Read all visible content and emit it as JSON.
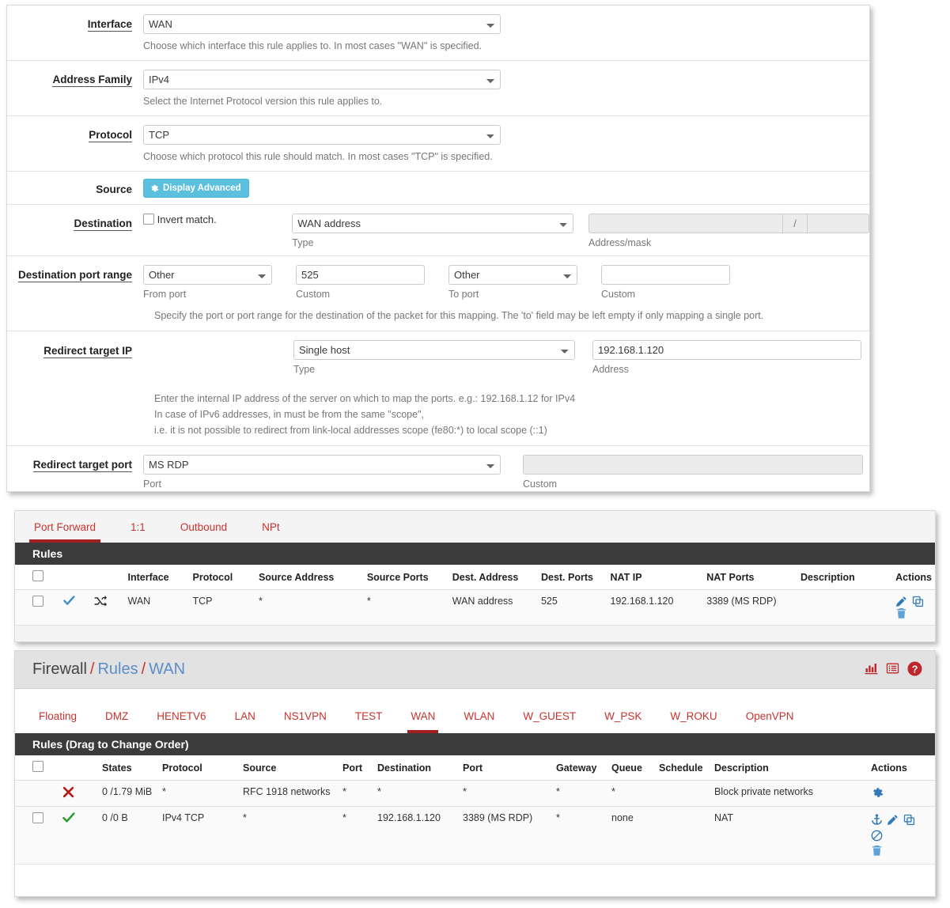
{
  "form": {
    "rows": [
      {
        "label": "Interface",
        "control": "select",
        "value": "WAN",
        "help": "Choose which interface this rule applies to. In most cases \"WAN\" is specified."
      },
      {
        "label": "Address Family",
        "control": "select",
        "value": "IPv4",
        "help": "Select the Internet Protocol version this rule applies to."
      },
      {
        "label": "Protocol",
        "control": "select",
        "value": "TCP",
        "help": "Choose which protocol this rule should match. In most cases \"TCP\" is specified."
      }
    ],
    "source": {
      "label": "Source",
      "advanced_button": "Display Advanced",
      "gear_icon": "gear-icon"
    },
    "destination": {
      "label": "Destination",
      "invert_label": "Invert match.",
      "type_value": "WAN address",
      "type_sublabel": "Type",
      "address_value": "",
      "address_sublabel": "Address/mask",
      "slash": "/",
      "bits_value": ""
    },
    "dest_port_range": {
      "label": "Destination port range",
      "from_port_value": "Other",
      "from_port_sublabel": "From port",
      "from_custom_value": "525",
      "from_custom_sublabel": "Custom",
      "to_port_value": "Other",
      "to_port_sublabel": "To port",
      "to_custom_value": "",
      "to_custom_sublabel": "Custom",
      "help": "Specify the port or port range for the destination of the packet for this mapping. The 'to' field may be left empty if only mapping a single port."
    },
    "redirect_target_ip": {
      "label": "Redirect target IP",
      "type_value": "Single host",
      "type_sublabel": "Type",
      "address_value": "192.168.1.120",
      "address_sublabel": "Address",
      "help_line1": "Enter the internal IP address of the server on which to map the ports. e.g.: 192.168.1.12 for IPv4",
      "help_line2": "In case of IPv6 addresses, in must be from the same \"scope\",",
      "help_line3": "i.e. it is not possible to redirect from link-local addresses scope (fe80:*) to local scope (::1)"
    },
    "redirect_target_port": {
      "label": "Redirect target port",
      "port_value": "MS RDP",
      "port_sublabel": "Port",
      "custom_value": "",
      "custom_sublabel": "Custom"
    }
  },
  "nat": {
    "tabs": [
      {
        "label": "Port Forward",
        "active": true
      },
      {
        "label": "1:1",
        "active": false
      },
      {
        "label": "Outbound",
        "active": false
      },
      {
        "label": "NPt",
        "active": false
      }
    ],
    "table_title": "Rules",
    "columns": [
      "",
      "",
      "",
      "Interface",
      "Protocol",
      "Source Address",
      "Source Ports",
      "Dest. Address",
      "Dest. Ports",
      "NAT IP",
      "NAT Ports",
      "Description",
      "Actions"
    ],
    "rows": [
      {
        "enabled_icon": "check-icon",
        "type_icon": "shuffle-icon",
        "interface": "WAN",
        "protocol": "TCP",
        "source_address": "*",
        "source_ports": "*",
        "dest_address": "WAN address",
        "dest_ports": "525",
        "nat_ip": "192.168.1.120",
        "nat_ports": "3389 (MS RDP)",
        "description": "",
        "actions": [
          "pencil-icon",
          "copy-icon",
          "trash-icon"
        ]
      }
    ]
  },
  "firewall": {
    "breadcrumb": {
      "root": "Firewall",
      "sep": "/",
      "section": "Rules",
      "current": "WAN"
    },
    "header_icons": [
      "bar-chart-icon",
      "log-list-icon",
      "help-icon"
    ],
    "tabs": [
      {
        "label": "Floating",
        "active": false
      },
      {
        "label": "DMZ",
        "active": false
      },
      {
        "label": "HENETV6",
        "active": false
      },
      {
        "label": "LAN",
        "active": false
      },
      {
        "label": "NS1VPN",
        "active": false
      },
      {
        "label": "TEST",
        "active": false
      },
      {
        "label": "WAN",
        "active": true
      },
      {
        "label": "WLAN",
        "active": false
      },
      {
        "label": "W_GUEST",
        "active": false
      },
      {
        "label": "W_PSK",
        "active": false
      },
      {
        "label": "W_ROKU",
        "active": false
      },
      {
        "label": "OpenVPN",
        "active": false
      }
    ],
    "table_title": "Rules (Drag to Change Order)",
    "columns": [
      "",
      "",
      "States",
      "Protocol",
      "Source",
      "Port",
      "Destination",
      "Port",
      "Gateway",
      "Queue",
      "Schedule",
      "Description",
      "Actions"
    ],
    "rows": [
      {
        "has_checkbox": false,
        "status_icon": "block-x-icon",
        "states": "0 /1.79 MiB",
        "protocol": "*",
        "source": "RFC 1918 networks",
        "source_port": "*",
        "destination": "*",
        "dest_port": "*",
        "gateway": "*",
        "queue": "*",
        "schedule": "",
        "description": "Block private networks",
        "actions": [
          "gear-icon"
        ]
      },
      {
        "has_checkbox": true,
        "status_icon": "pass-check-icon",
        "states": "0 /0 B",
        "protocol": "IPv4 TCP",
        "source": "*",
        "source_port": "*",
        "destination": "192.168.1.120",
        "dest_port": "3389 (MS RDP)",
        "gateway": "*",
        "queue": "none",
        "schedule": "",
        "description": "NAT",
        "actions": [
          "anchor-icon",
          "pencil-icon",
          "copy-icon",
          "block-icon",
          "trash-icon"
        ]
      }
    ]
  },
  "colors": {
    "accent_red": "#c9332e",
    "active_tab_underline": "#a32020",
    "info_blue": "#5bc0de",
    "link_blue": "#337ab7",
    "header_dark": "#3b3b3b",
    "pass_green": "#2e9e2e",
    "block_red": "#b31919"
  }
}
